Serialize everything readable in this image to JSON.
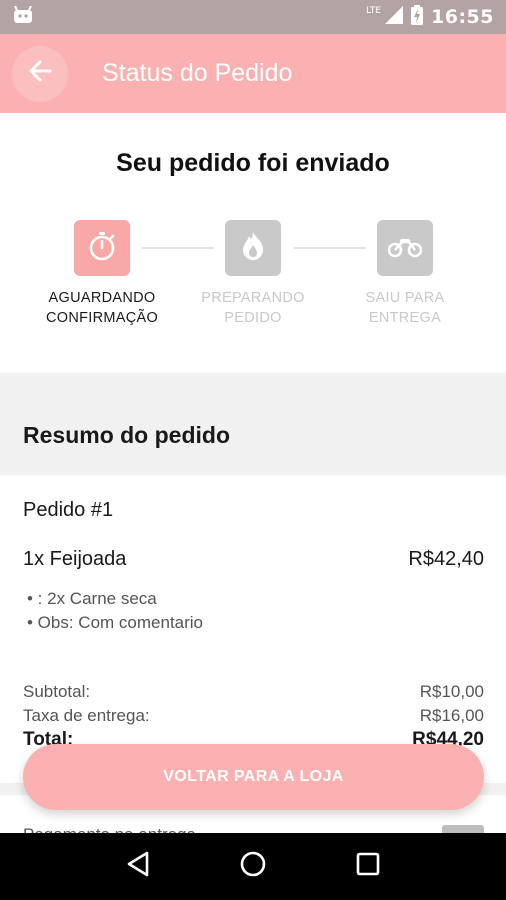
{
  "status_bar": {
    "network": "LTE",
    "time": "16:55",
    "icons": [
      "android-icon",
      "signal-icon",
      "battery-charging-icon"
    ]
  },
  "app_bar": {
    "title": "Status do Pedido",
    "back_icon": "arrow-left-icon"
  },
  "headline": "Seu pedido foi enviado",
  "steps": [
    {
      "line1": "AGUARDANDO",
      "line2": "CONFIRMAÇÃO",
      "icon": "stopwatch-icon",
      "state": "active"
    },
    {
      "line1": "PREPARANDO",
      "line2": "PEDIDO",
      "icon": "flame-icon",
      "state": "inactive"
    },
    {
      "line1": "SAIU PARA",
      "line2": "ENTREGA",
      "icon": "motorcycle-icon",
      "state": "inactive"
    }
  ],
  "summary": {
    "title": "Resumo do pedido",
    "order_id": "Pedido #1",
    "item": {
      "name": "1x Feijoada",
      "price": "R$42,40"
    },
    "notes": [
      "• : 2x Carne seca",
      "• Obs: Com comentario"
    ],
    "subtotal": {
      "label": "Subtotal:",
      "value": "R$10,00"
    },
    "delivery_fee": {
      "label": "Taxa de entrega:",
      "value": "R$16,00"
    },
    "total": {
      "label": "Total:",
      "value": "R$44,20"
    },
    "next_row": {
      "label": "Pagamento na entrega"
    }
  },
  "cta": {
    "label": "VOLTAR PARA A LOJA"
  },
  "nav_bar": {
    "icons": [
      "back-triangle-icon",
      "home-circle-icon",
      "recents-square-icon"
    ]
  },
  "colors": {
    "accent": "#fbb1b1",
    "accent_step": "#f9a8a8",
    "inactive": "#c9c9c9",
    "status_bar": "#b3a3a3",
    "section_bg": "#f1f1f1"
  }
}
